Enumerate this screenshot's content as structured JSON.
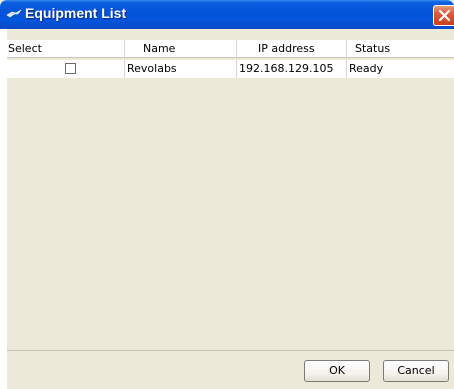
{
  "window": {
    "title": "Equipment List",
    "title_icon": "app-icon"
  },
  "table": {
    "columns": [
      "Select",
      "Name",
      "IP address",
      "Status"
    ],
    "rows": [
      {
        "selected": false,
        "name": "Revolabs",
        "ip": "192.168.129.105",
        "status": "Ready"
      }
    ]
  },
  "buttons": {
    "ok_label": "OK",
    "cancel_label": "Cancel"
  },
  "colors": {
    "titlebar": "#0553d9",
    "window_bg": "#ece9d8",
    "close_button": "#e0593a"
  }
}
